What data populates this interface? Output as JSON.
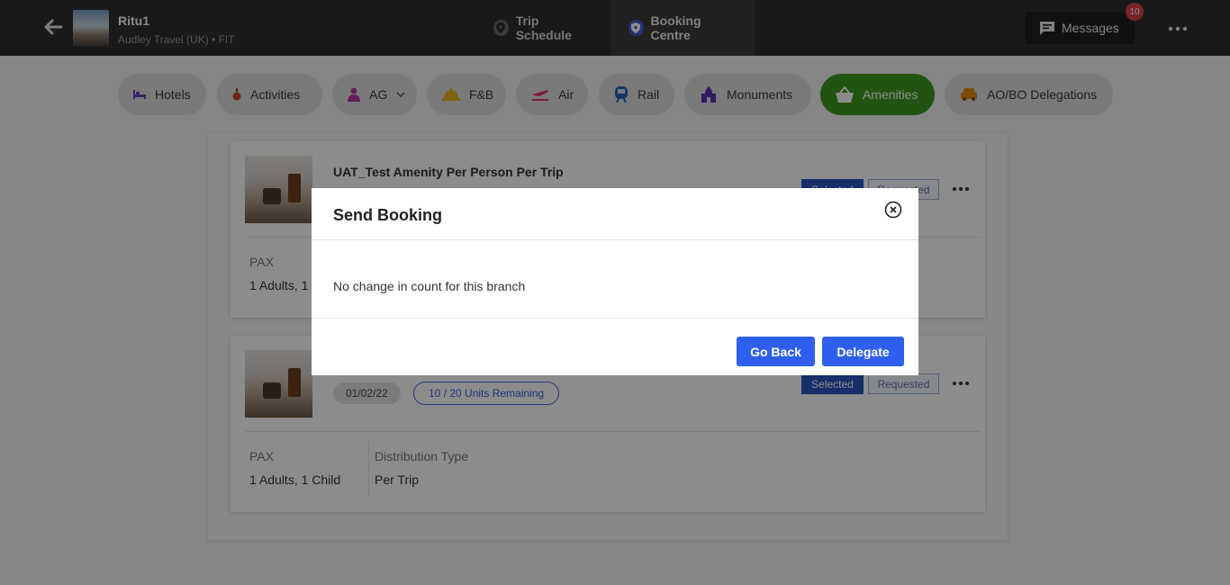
{
  "header": {
    "trip_name": "Ritu1",
    "trip_sub": "Audley Travel (UK) • FIT",
    "tabs": [
      {
        "label": "Trip Schedule",
        "icon": "location-icon"
      },
      {
        "label": "Booking Centre",
        "icon": "shield-icon",
        "active": true
      }
    ],
    "messages_label": "Messages",
    "messages_count": "10"
  },
  "categories": [
    {
      "label": "Hotels",
      "icon": "bed-icon"
    },
    {
      "label": "Activities",
      "icon": "perfume-icon"
    },
    {
      "label": "AG",
      "icon": "person-icon",
      "has_dropdown": true
    },
    {
      "label": "F&B",
      "icon": "cloche-icon"
    },
    {
      "label": "Air",
      "icon": "plane-icon"
    },
    {
      "label": "Rail",
      "icon": "train-icon"
    },
    {
      "label": "Monuments",
      "icon": "monument-icon"
    },
    {
      "label": "Amenities",
      "icon": "basket-icon",
      "active": true
    },
    {
      "label": "AO/BO Delegations",
      "icon": "taxi-icon"
    }
  ],
  "cards": [
    {
      "title": "UAT_Test Amenity Per Person Per Trip",
      "status_selected": "Selected",
      "status_requested": "Requested",
      "pax_label": "PAX",
      "pax_value": "1 Adults, 1",
      "distribution_label": "",
      "distribution_value": ""
    },
    {
      "date": "01/02/22",
      "units": "10 / 20 Units Remaining",
      "status_selected": "Selected",
      "status_requested": "Requested",
      "pax_label": "PAX",
      "pax_value": "1 Adults, 1 Child",
      "distribution_label": "Distribution Type",
      "distribution_value": "Per Trip"
    }
  ],
  "modal": {
    "title": "Send Booking",
    "message": "No change in count for this branch",
    "go_back_label": "Go Back",
    "delegate_label": "Delegate"
  },
  "colors": {
    "topbar": "#2f2f2f",
    "active_chip": "#3d9a1f",
    "primary_button": "#2f5ff0",
    "selected_badge": "#2c54c4",
    "notification_badge": "#d9434b"
  }
}
